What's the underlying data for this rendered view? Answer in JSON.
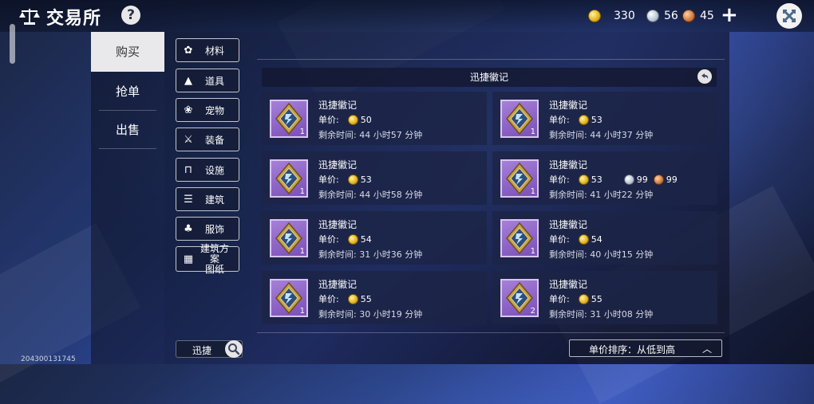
{
  "header": {
    "title": "交易所",
    "help_label": "?"
  },
  "currency": {
    "gold": "330",
    "silver": "56",
    "bronze": "45",
    "add_label": "+"
  },
  "tabs": [
    {
      "label": "购买",
      "active": true
    },
    {
      "label": "抢单",
      "active": false
    },
    {
      "label": "出售",
      "active": false
    }
  ],
  "categories": [
    {
      "label": "材料",
      "icon": "material-icon"
    },
    {
      "label": "道具",
      "icon": "prop-icon"
    },
    {
      "label": "宠物",
      "icon": "pet-paw-icon"
    },
    {
      "label": "装备",
      "icon": "equipment-icon"
    },
    {
      "label": "设施",
      "icon": "facility-icon"
    },
    {
      "label": "建筑",
      "icon": "building-icon"
    },
    {
      "label": "服饰",
      "icon": "clothing-icon"
    },
    {
      "label": "建筑方案\n图纸",
      "icon": "blueprint-icon"
    }
  ],
  "search": {
    "value": "迅捷"
  },
  "listing": {
    "header": "迅捷徽记",
    "price_label": "单价:",
    "items": [
      {
        "name": "迅捷徽记",
        "qty": "1",
        "gold": "50",
        "silver": "",
        "bronze": "",
        "time": "剩余时间: 44 小时57 分钟"
      },
      {
        "name": "迅捷徽记",
        "qty": "1",
        "gold": "53",
        "silver": "",
        "bronze": "",
        "time": "剩余时间: 44 小时37 分钟"
      },
      {
        "name": "迅捷徽记",
        "qty": "1",
        "gold": "53",
        "silver": "",
        "bronze": "",
        "time": "剩余时间: 44 小时58 分钟"
      },
      {
        "name": "迅捷徽记",
        "qty": "1",
        "gold": "53",
        "silver": "99",
        "bronze": "99",
        "time": "剩余时间: 41 小时22 分钟"
      },
      {
        "name": "迅捷徽记",
        "qty": "1",
        "gold": "54",
        "silver": "",
        "bronze": "",
        "time": "剩余时间: 31 小时36 分钟"
      },
      {
        "name": "迅捷徽记",
        "qty": "1",
        "gold": "54",
        "silver": "",
        "bronze": "",
        "time": "剩余时间: 40 小时15 分钟"
      },
      {
        "name": "迅捷徽记",
        "qty": "1",
        "gold": "55",
        "silver": "",
        "bronze": "",
        "time": "剩余时间: 30 小时19 分钟"
      },
      {
        "name": "迅捷徽记",
        "qty": "2",
        "gold": "55",
        "silver": "",
        "bronze": "",
        "time": "剩余时间: 31 小时08 分钟"
      }
    ]
  },
  "sort": {
    "label": "单价排序：从低到高"
  },
  "user_id": "204300131745"
}
